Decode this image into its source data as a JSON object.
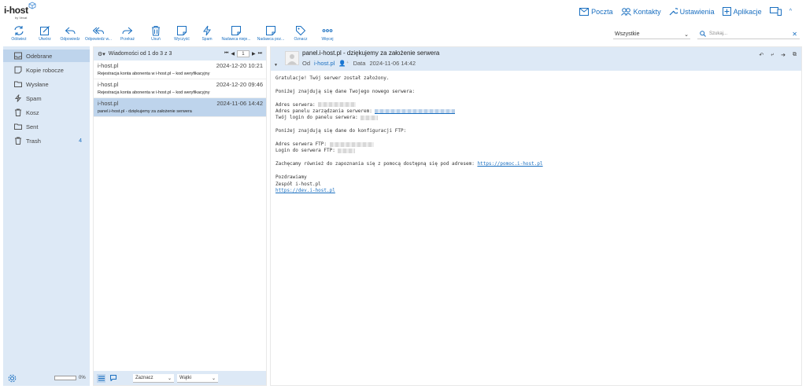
{
  "brand": {
    "name": "i-host",
    "sub": "by Vevat"
  },
  "topnav": {
    "mail": "Poczta",
    "contacts": "Kontakty",
    "settings": "Ustawienia",
    "apps": "Aplikacje"
  },
  "toolbar": {
    "refresh": "Odśwież",
    "compose": "Utwórz",
    "reply": "Odpowiedz",
    "reply_all": "Odpowiedz w...",
    "forward": "Przekaż",
    "delete": "Usuń",
    "empty": "Wyczyść",
    "spam": "Spam",
    "sender1": "Nadawca nieje...",
    "sender2": "Nadawca poz...",
    "mark": "Oznacz",
    "more": "Więcej"
  },
  "filter": {
    "value": "Wszystkie"
  },
  "search": {
    "placeholder": "Szukaj..."
  },
  "sidebar": {
    "items": [
      {
        "label": "Odebrane",
        "count": ""
      },
      {
        "label": "Kopie robocze",
        "count": ""
      },
      {
        "label": "Wysłane",
        "count": ""
      },
      {
        "label": "Spam",
        "count": ""
      },
      {
        "label": "Kosz",
        "count": ""
      },
      {
        "label": "Sent",
        "count": ""
      },
      {
        "label": "Trash",
        "count": "4"
      }
    ],
    "quota": "0%",
    "quota_fraction": 0
  },
  "list": {
    "header": "Wiadomości od 1 do 3 z 3",
    "page": "1",
    "messages": [
      {
        "from": "i-host.pl",
        "date": "2024-12-20 10:21",
        "subject": "Rejestracja konta abonenta w i-host.pl – kod weryfikacyjny"
      },
      {
        "from": "i-host.pl",
        "date": "2024-12-20 09:46",
        "subject": "Rejestracja konta abonenta w i-host.pl – kod weryfikacyjny"
      },
      {
        "from": "i-host.pl",
        "date": "2024-11-06 14:42",
        "subject": "panel.i-host.pl - dziękujemy za założenie serwera"
      }
    ],
    "footer": {
      "select": "Zaznacz",
      "threads": "Wątki"
    }
  },
  "reader": {
    "subject": "panel.i-host.pl - dziękujemy za założenie serwera",
    "from_label": "Od",
    "from": "i-host.pl",
    "date_label": "Data",
    "date": "2024-11-06 14:42",
    "body": {
      "l1": "Gratulacje! Twój serwer został założony.",
      "l2": "Poniżej znajdują się dane Twojego nowego serwera:",
      "l3": "Adres serwera: ",
      "l4": "Adres panelu zarządzania serwerem: ",
      "l5": "Twój login do panelu serwera: ",
      "l6": "Poniżej znajdują się dane do konfiguracji FTP:",
      "l7": "Adres serwera FTP: ",
      "l8": "Login do serwera FTP: ",
      "l9": "Zachęcamy również do zapoznania się z pomocą dostępną się pod adresem: ",
      "help_link": "https://pomoc.i-host.pl",
      "l10": "Pozdrawiamy",
      "l11": "Zespół i-host.pl",
      "dev_link": "https://dev.i-host.pl"
    }
  },
  "colors": {
    "accent": "#1a6fc0",
    "panel": "#dde9f6",
    "selected": "#bed4ec"
  }
}
